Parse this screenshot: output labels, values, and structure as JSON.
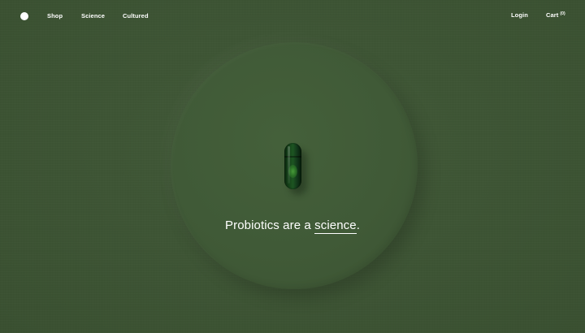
{
  "nav": {
    "logo_icon": "circle-logo-icon",
    "links": {
      "shop": "Shop",
      "science": "Science",
      "cultured": "Cultured"
    },
    "login": "Login",
    "cart": {
      "label": "Cart",
      "count": "(0)"
    }
  },
  "hero": {
    "headline_prefix": "Probiotics are a ",
    "headline_link": "science",
    "headline_suffix": ".",
    "image_icon": "capsule-pill-icon"
  },
  "colors": {
    "background": "#3d5434",
    "text": "#ffffff",
    "capsule": "#17461b"
  }
}
